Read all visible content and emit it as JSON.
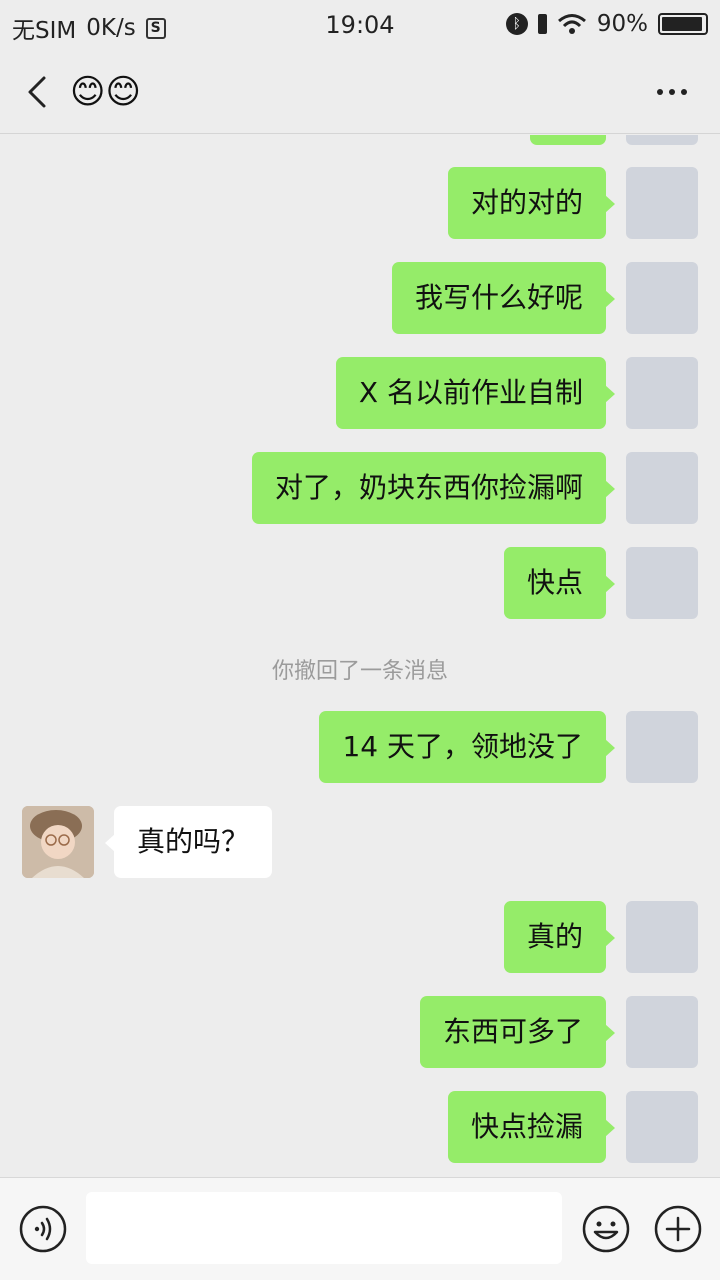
{
  "status_bar": {
    "carrier": "无SIM",
    "speed": "0K/s",
    "sim_icon_glyph": "S",
    "time": "19:04",
    "battery": "90%",
    "icons": [
      "sim-card-icon",
      "bluetooth-icon",
      "vibrate-icon",
      "wifi-icon",
      "battery-icon"
    ]
  },
  "header": {
    "title": "😊😊",
    "icons": [
      "back-arrow-icon",
      "more-dots-icon"
    ]
  },
  "messages": [
    {
      "sender": "me",
      "text": "对的对的"
    },
    {
      "sender": "me",
      "text": "我写什么好呢"
    },
    {
      "sender": "me",
      "text": "X 名以前作业自制"
    },
    {
      "sender": "me",
      "text": "对了，奶块东西你捡漏啊"
    },
    {
      "sender": "me",
      "text": "快点"
    },
    {
      "sender": "system",
      "text": "你撤回了一条消息"
    },
    {
      "sender": "me",
      "text": "14 天了，领地没了"
    },
    {
      "sender": "other",
      "text": "真的吗？"
    },
    {
      "sender": "me",
      "text": "真的"
    },
    {
      "sender": "me",
      "text": "东西可多了"
    },
    {
      "sender": "me",
      "text": "快点捡漏"
    }
  ],
  "input_bar": {
    "value": "",
    "icons": [
      "voice-icon",
      "emoji-icon",
      "plus-icon"
    ]
  },
  "colors": {
    "background": "#ededed",
    "my_bubble": "#95ec69",
    "other_bubble": "#ffffff",
    "system_text": "#9b9b9b"
  }
}
